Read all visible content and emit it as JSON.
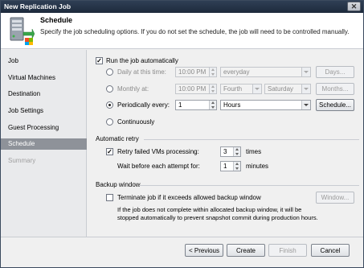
{
  "window": {
    "title": "New Replication Job",
    "close_glyph": "✕"
  },
  "header": {
    "title": "Schedule",
    "description": "Specify the job scheduling options. If you do not set the schedule, the job will need to be controlled manually."
  },
  "sidebar": {
    "items": [
      {
        "label": "Job"
      },
      {
        "label": "Virtual Machines"
      },
      {
        "label": "Destination"
      },
      {
        "label": "Job Settings"
      },
      {
        "label": "Guest Processing"
      },
      {
        "label": "Schedule"
      },
      {
        "label": "Summary"
      }
    ]
  },
  "schedule": {
    "run_auto_label": "Run the job automatically",
    "daily_label": "Daily at this time:",
    "daily_time": "10:00 PM",
    "daily_days": "everyday",
    "days_button": "Days...",
    "monthly_label": "Monthly at:",
    "monthly_time": "10:00 PM",
    "monthly_week": "Fourth",
    "monthly_day": "Saturday",
    "months_button": "Months...",
    "periodic_label": "Periodically every:",
    "periodic_value": "1",
    "periodic_unit": "Hours",
    "schedule_button": "Schedule...",
    "continuous_label": "Continuously",
    "selected_mode": "periodically"
  },
  "retry": {
    "section_label": "Automatic retry",
    "retry_label": "Retry failed VMs processing:",
    "retry_value": "3",
    "retry_unit": "times",
    "wait_label": "Wait before each attempt for:",
    "wait_value": "1",
    "wait_unit": "minutes"
  },
  "backup_window": {
    "section_label": "Backup window",
    "terminate_label": "Terminate job if it exceeds allowed backup window",
    "window_button": "Window...",
    "note_line1": "If the job does not complete within allocated backup window, it will be",
    "note_line2": "stopped automatically to prevent snapshot commit during production hours."
  },
  "footer": {
    "previous": "< Previous",
    "create": "Create",
    "finish": "Finish",
    "cancel": "Cancel"
  },
  "check_glyph": "✓"
}
